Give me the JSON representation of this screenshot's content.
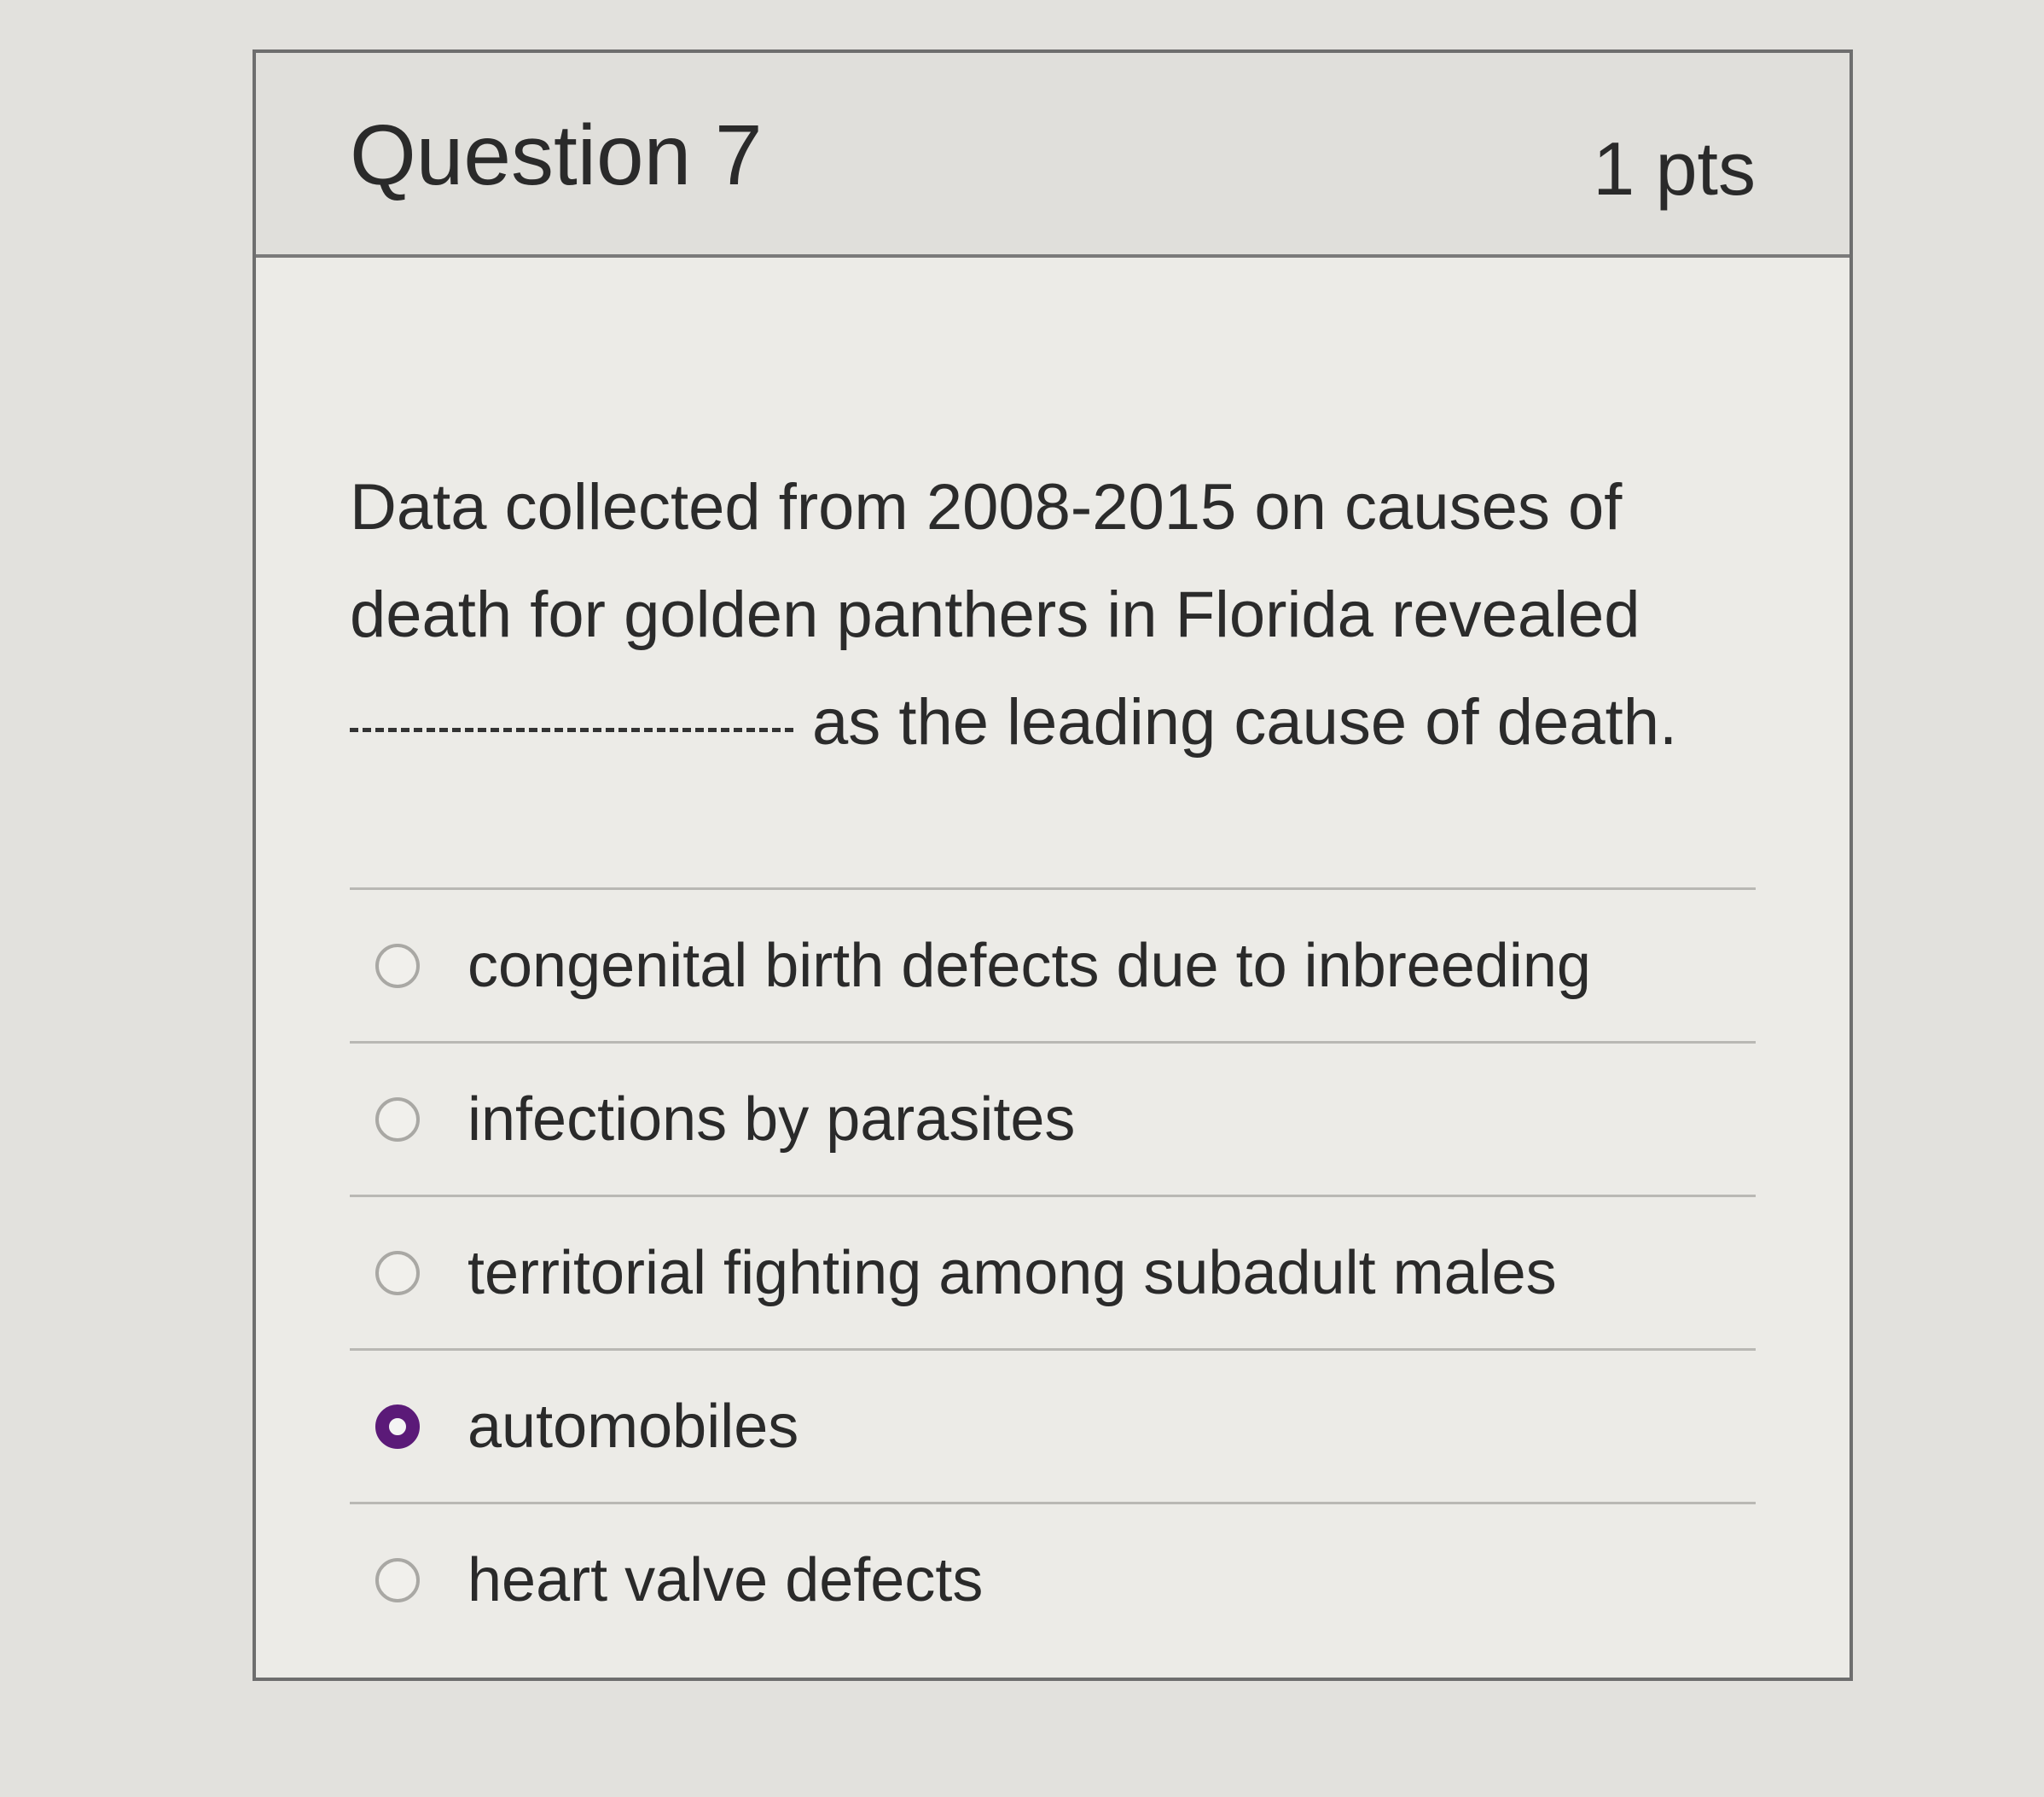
{
  "question": {
    "title": "Question 7",
    "points": "1 pts",
    "text_before_blank": "Data collected from 2008-2015 on causes of death for golden panthers in Florida revealed",
    "text_after_blank": "as the leading cause of death."
  },
  "answers": [
    {
      "label": "congenital birth defects due to inbreeding",
      "selected": false
    },
    {
      "label": "infections by parasites",
      "selected": false
    },
    {
      "label": "territorial fighting among subadult males",
      "selected": false
    },
    {
      "label": "automobiles",
      "selected": true
    },
    {
      "label": "heart valve defects",
      "selected": false
    }
  ],
  "colors": {
    "selected_radio": "#5b1a78",
    "card_border": "#6e6e6e",
    "header_background": "#e0dfdb"
  }
}
